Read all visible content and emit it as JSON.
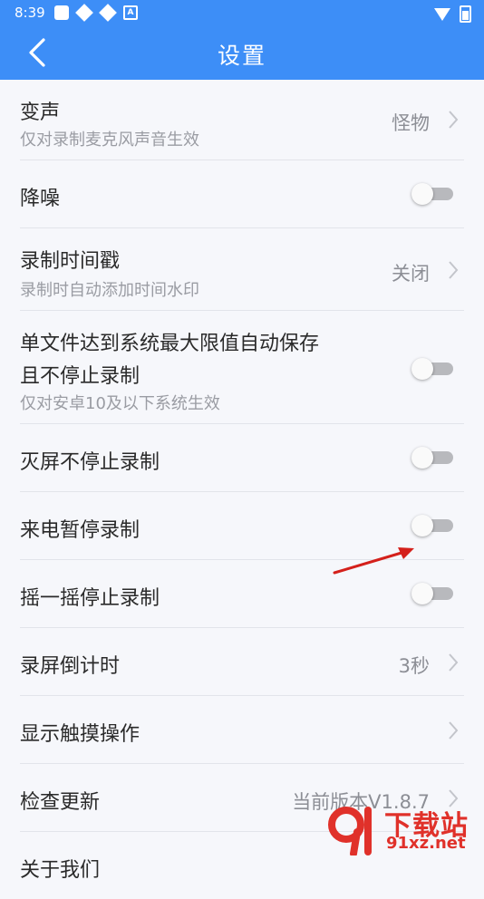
{
  "status": {
    "time": "8:39",
    "a_icon_text": "A"
  },
  "header": {
    "title": "设置"
  },
  "rows": [
    {
      "label": "变声",
      "sub": "仅对录制麦克风声音生效",
      "value": "怪物"
    },
    {
      "label": "降噪",
      "toggle": false
    },
    {
      "label": "录制时间戳",
      "sub": "录制时自动添加时间水印",
      "value": "关闭"
    },
    {
      "label_line1": "单文件达到系统最大限值自动保存",
      "label_line2": "且不停止录制",
      "sub": "仅对安卓10及以下系统生效",
      "toggle": false
    },
    {
      "label": "灭屏不停止录制",
      "toggle": false
    },
    {
      "label": "来电暂停录制",
      "toggle": false
    },
    {
      "label": "摇一摇停止录制",
      "toggle": false
    },
    {
      "label": "录屏倒计时",
      "value": "3秒"
    },
    {
      "label": "显示触摸操作"
    },
    {
      "label": "检查更新",
      "value": "当前版本V1.8.7"
    },
    {
      "label": "关于我们"
    }
  ],
  "colors": {
    "accent": "#3d8ef7",
    "annotation_arrow": "#d4201b",
    "watermark": "#e0312a"
  },
  "watermark": {
    "text_main": "下载站",
    "text_url": "91xz.net"
  }
}
